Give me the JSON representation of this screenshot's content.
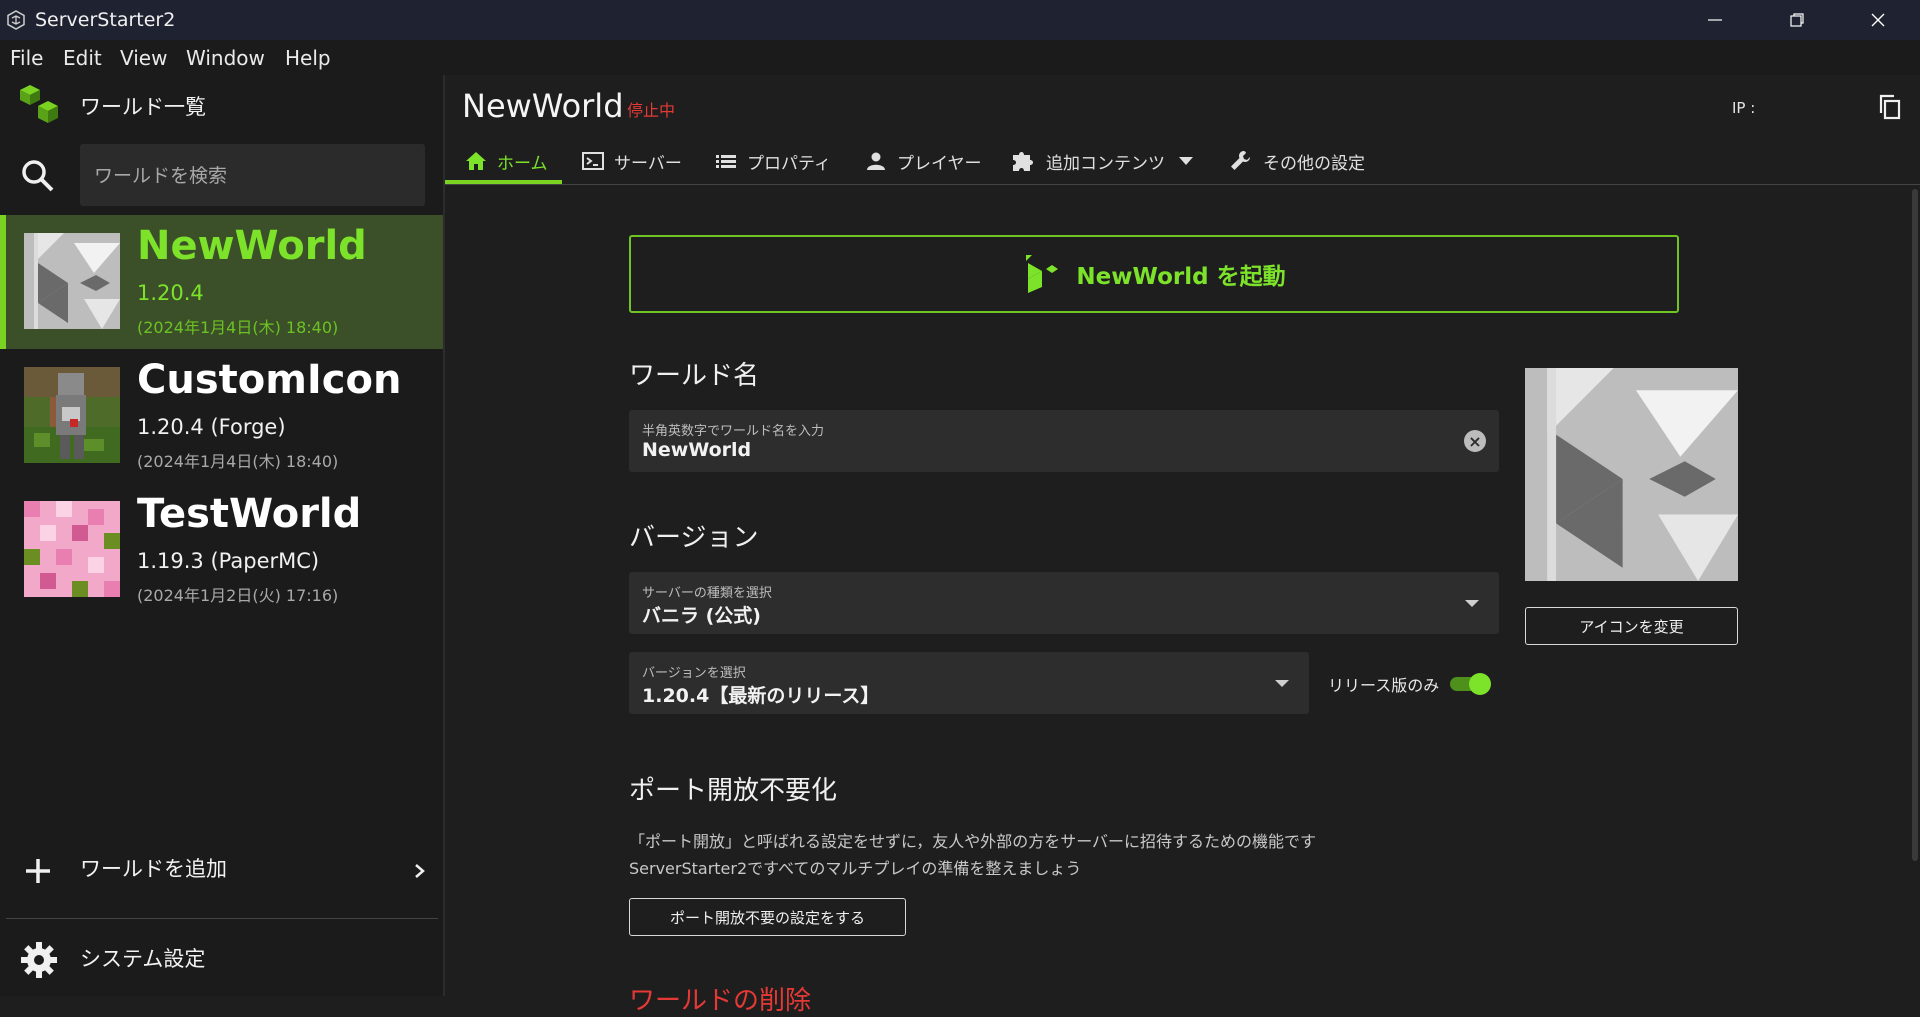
{
  "window": {
    "title": "ServerStarter2",
    "minimize_label": "—",
    "restore_label": "❐",
    "close_label": "✕"
  },
  "menu": [
    "File",
    "Edit",
    "View",
    "Window",
    "Help"
  ],
  "sidebar": {
    "header_label": "ワールド一覧",
    "search_placeholder": "ワールドを検索",
    "worlds": [
      {
        "name": "NewWorld",
        "version": "1.20.4",
        "date": "(2024年1月4日(木) 18:40)",
        "selected": true
      },
      {
        "name": "CustomIcon",
        "version": "1.20.4 (Forge)",
        "date": "(2024年1月4日(木) 18:40)",
        "selected": false
      },
      {
        "name": "TestWorld",
        "version": "1.19.3 (PaperMC)",
        "date": "(2024年1月2日(火) 17:16)",
        "selected": false
      }
    ],
    "add_world_label": "ワールドを追加",
    "system_settings_label": "システム設定"
  },
  "main": {
    "title": "NewWorld",
    "status": "停止中",
    "ip_label": "IP :",
    "tabs": [
      {
        "label": "ホーム",
        "icon": "home-icon",
        "active": true
      },
      {
        "label": "サーバー",
        "icon": "terminal-icon",
        "active": false
      },
      {
        "label": "プロパティ",
        "icon": "list-icon",
        "active": false
      },
      {
        "label": "プレイヤー",
        "icon": "person-icon",
        "active": false
      },
      {
        "label": "追加コンテンツ",
        "icon": "puzzle-icon",
        "active": false
      },
      {
        "label": "その他の設定",
        "icon": "wrench-icon",
        "active": false
      }
    ],
    "launch_button": "NewWorld を起動",
    "world_name": {
      "section_title": "ワールド名",
      "field_label": "半角英数字でワールド名を入力",
      "value": "NewWorld"
    },
    "version": {
      "section_title": "バージョン",
      "server_type_label": "サーバーの種類を選択",
      "server_type_value": "バニラ (公式)",
      "version_label": "バージョンを選択",
      "version_value": "1.20.4【最新のリリース】",
      "release_only_label": "リリース版のみ",
      "release_only": true
    },
    "change_icon_button": "アイコンを変更",
    "port": {
      "section_title": "ポート開放不要化",
      "desc_line1": "「ポート開放」と呼ばれる設定をせずに，友人や外部の方をサーバーに招待するための機能です",
      "desc_line2": "ServerStarter2ですべてのマルチプレイの準備を整えましょう",
      "button": "ポート開放不要の設定をする"
    },
    "delete_section_title": "ワールドの削除"
  },
  "colors": {
    "accent": "#7ce22a",
    "danger": "#e53935",
    "titlebar": "#1f2231",
    "sidebar_bg": "#1b1b1b",
    "main_bg": "#1e1e1e",
    "selected_bg": "#3b5028"
  }
}
